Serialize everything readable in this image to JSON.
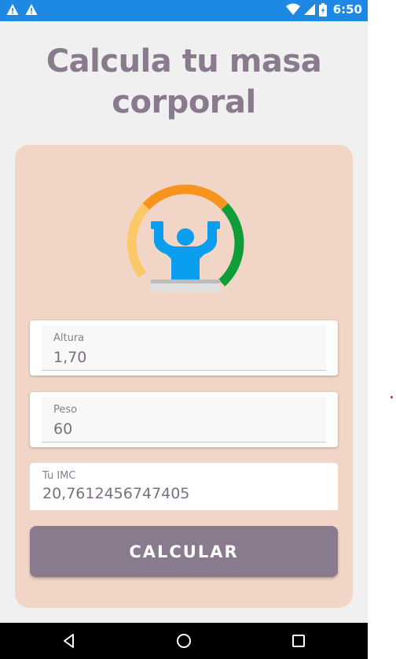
{
  "status_bar": {
    "time": "6:50",
    "icons": [
      "warning-icon",
      "warning-icon",
      "wifi-icon",
      "signal-icon",
      "battery-icon"
    ]
  },
  "header": {
    "title_line1": "Calcula tu masa",
    "title_line2": "corporal"
  },
  "card": {
    "logo_icon": "strongman-gauge-icon",
    "fields": [
      {
        "label": "Altura",
        "value": "1,70"
      },
      {
        "label": "Peso",
        "value": "60"
      }
    ],
    "result": {
      "label": "Tu IMC",
      "value": "20,7612456747405"
    },
    "button_label": "CALCULAR"
  },
  "nav_bar": {
    "icons": [
      "back-icon",
      "home-icon",
      "recent-apps-icon"
    ]
  },
  "colors": {
    "status_bar": "#1e88e5",
    "accent": "#8a7a8e",
    "card": "#f1d5c7",
    "gauge_orange": "#f7941d",
    "gauge_yellow": "#fdc86a",
    "gauge_green": "#0f9d3a",
    "figure_blue": "#0b9dee"
  }
}
